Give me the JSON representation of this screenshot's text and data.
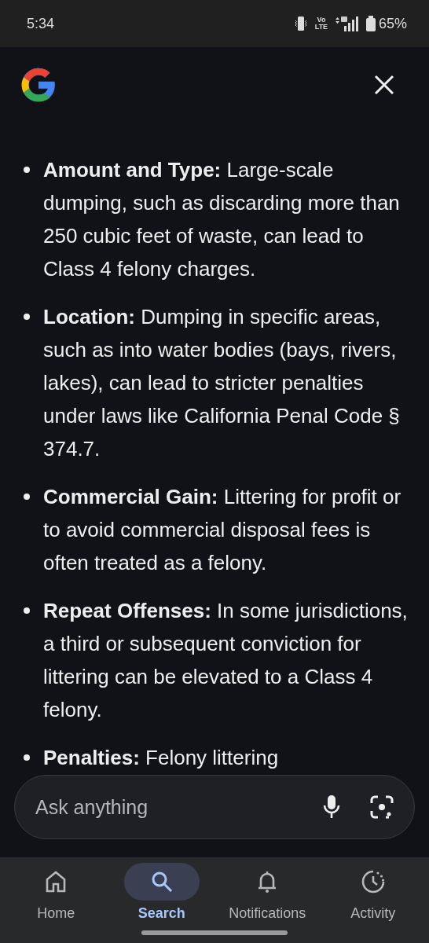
{
  "status_bar": {
    "time": "5:34",
    "network": "Vo LTE",
    "battery": "65%"
  },
  "answer": {
    "bullets": [
      {
        "text": "**Amount and Type:** Large-scale dumping, such as discarding more than 250 cubic feet of waste, can lead to Class 4 felony charges."
      },
      {
        "text": "**Location:** Dumping in specific areas, such as into water bodies (bays, rivers, lakes), can lead to stricter penalties under laws like California Penal Code § 374.7."
      },
      {
        "text": "**Commercial Gain:** Littering for profit or to avoid commercial disposal fees is often treated as a felony."
      },
      {
        "text": "**Repeat Offenses:** In some jurisdictions, a third or subsequent conviction for littering can be elevated to a Class 4 felony."
      },
      {
        "text": "**Penalties:** Felony littering"
      }
    ]
  },
  "search": {
    "placeholder": "Ask anything"
  },
  "nav": [
    {
      "label": "Home",
      "kind": "home",
      "selected": false
    },
    {
      "label": "Search",
      "kind": "search",
      "selected": true
    },
    {
      "label": "Notifications",
      "kind": "bell",
      "selected": false
    },
    {
      "label": "Activity",
      "kind": "activity",
      "selected": false
    }
  ]
}
